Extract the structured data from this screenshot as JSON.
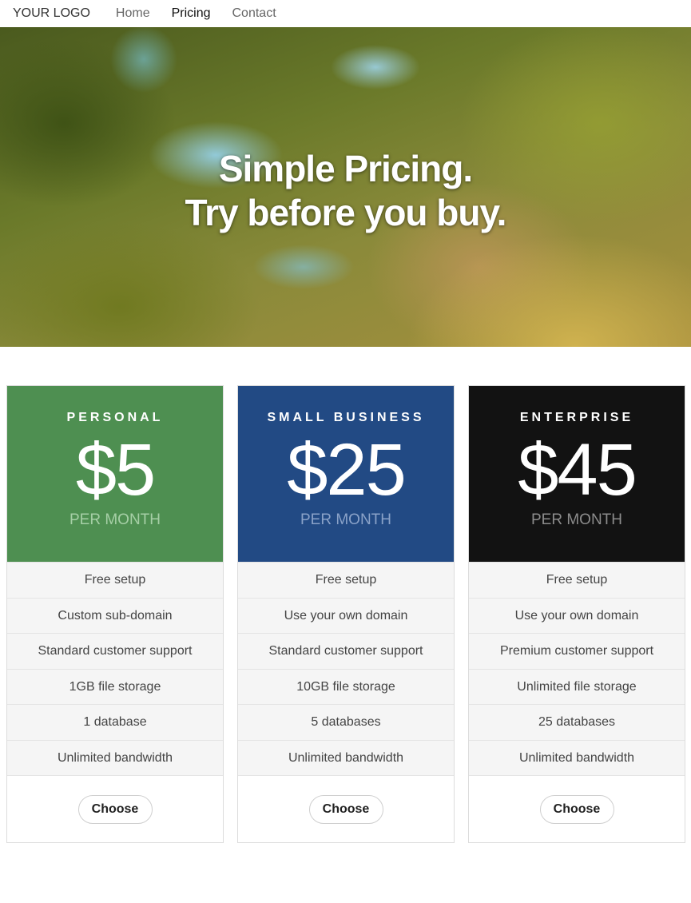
{
  "nav": {
    "logo": "YOUR LOGO",
    "links": [
      {
        "label": "Home",
        "active": false
      },
      {
        "label": "Pricing",
        "active": true
      },
      {
        "label": "Contact",
        "active": false
      }
    ]
  },
  "hero": {
    "line1": "Simple Pricing.",
    "line2": "Try before you buy."
  },
  "plans": [
    {
      "name": "PERSONAL",
      "price": "$5",
      "period": "PER MONTH",
      "color": "#4e8f51",
      "features": [
        "Free setup",
        "Custom sub-domain",
        "Standard customer support",
        "1GB file storage",
        "1 database",
        "Unlimited bandwidth"
      ],
      "button": "Choose"
    },
    {
      "name": "SMALL BUSINESS",
      "price": "$25",
      "period": "PER MONTH",
      "color": "#224a84",
      "features": [
        "Free setup",
        "Use your own domain",
        "Standard customer support",
        "10GB file storage",
        "5 databases",
        "Unlimited bandwidth"
      ],
      "button": "Choose"
    },
    {
      "name": "ENTERPRISE",
      "price": "$45",
      "period": "PER MONTH",
      "color": "#121212",
      "features": [
        "Free setup",
        "Use your own domain",
        "Premium customer support",
        "Unlimited file storage",
        "25 databases",
        "Unlimited bandwidth"
      ],
      "button": "Choose"
    }
  ]
}
